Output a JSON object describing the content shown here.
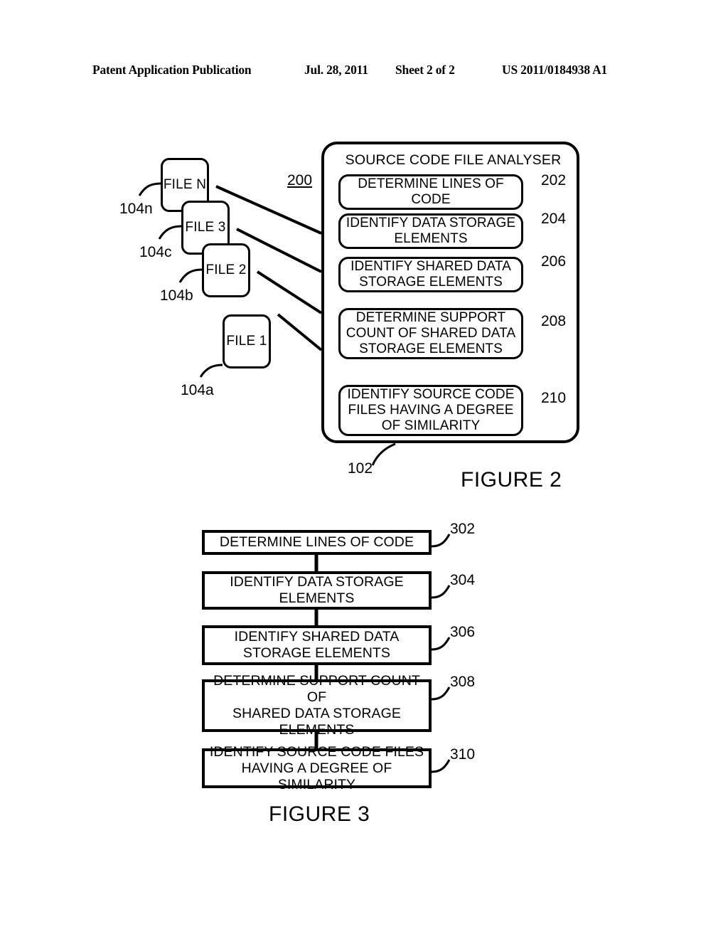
{
  "header": {
    "publication": "Patent Application Publication",
    "date": "Jul. 28, 2011",
    "sheet": "Sheet 2 of 2",
    "doc_number": "US 2011/0184938 A1"
  },
  "figure2": {
    "caption": "FIGURE 2",
    "system_ref": "200",
    "analyser": {
      "title": "SOURCE CODE FILE ANALYSER",
      "ref": "102",
      "steps": [
        {
          "ref": "202",
          "line1": "DETERMINE LINES OF",
          "line2": "CODE",
          "line3": ""
        },
        {
          "ref": "204",
          "line1": "IDENTIFY DATA STORAGE",
          "line2": "ELEMENTS",
          "line3": ""
        },
        {
          "ref": "206",
          "line1": "IDENTIFY SHARED  DATA",
          "line2": "STORAGE ELEMENTS",
          "line3": ""
        },
        {
          "ref": "208",
          "line1": "DETERMINE SUPPORT",
          "line2": "COUNT OF SHARED DATA",
          "line3": "STORAGE ELEMENTS"
        },
        {
          "ref": "210",
          "line1": "IDENTIFY SOURCE CODE",
          "line2": "FILES HAVING A DEGREE",
          "line3": "OF SIMILARITY"
        }
      ]
    },
    "files": [
      {
        "label": "FILE N",
        "ref": "104n"
      },
      {
        "label": "FILE 3",
        "ref": "104c"
      },
      {
        "label": "FILE 2",
        "ref": "104b"
      },
      {
        "label": "FILE 1",
        "ref": "104a"
      }
    ]
  },
  "figure3": {
    "caption": "FIGURE 3",
    "steps": [
      {
        "ref": "302",
        "line1": "DETERMINE LINES OF CODE",
        "line2": "",
        "line3": ""
      },
      {
        "ref": "304",
        "line1": "IDENTIFY DATA STORAGE",
        "line2": "ELEMENTS",
        "line3": ""
      },
      {
        "ref": "306",
        "line1": "IDENTIFY SHARED DATA",
        "line2": "STORAGE ELEMENTS",
        "line3": ""
      },
      {
        "ref": "308",
        "line1": "DETERMINE SUPPORT COUNT OF",
        "line2": "SHARED DATA STORAGE",
        "line3": "ELEMENTS"
      },
      {
        "ref": "310",
        "line1": "IDENTIFY SOURCE CODE FILES",
        "line2": "HAVING A DEGREE OF SIMILARITY",
        "line3": ""
      }
    ]
  }
}
